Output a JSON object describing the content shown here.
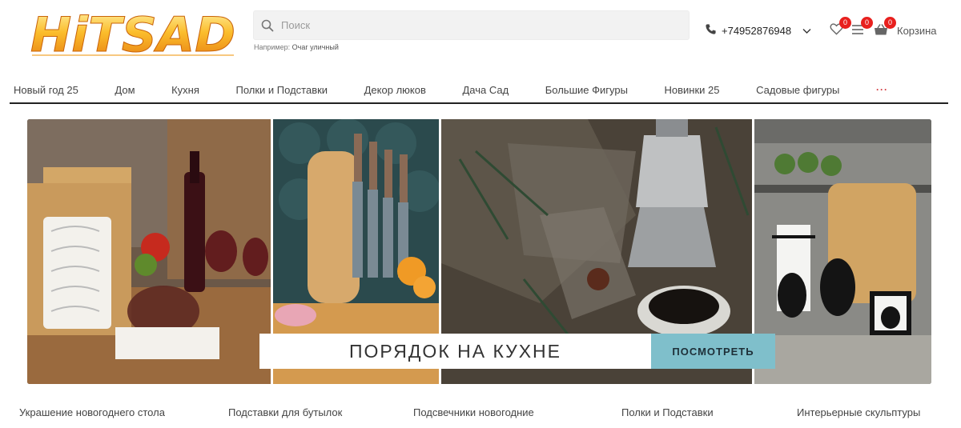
{
  "brand": {
    "logo_text": "HiTSAD"
  },
  "search": {
    "placeholder": "Поиск",
    "value": "",
    "hint_prefix": "Например:",
    "hint_example": "Очаг уличный"
  },
  "header": {
    "phone": "+74952876948",
    "wishlist_count": "0",
    "compare_count": "0",
    "cart_count": "0",
    "cart_label": "Корзина"
  },
  "nav": {
    "items": [
      "Новый год 25",
      "Дом",
      "Кухня",
      "Полки и Подставки",
      "Декор люков",
      "Дача Сад",
      "Большие Фигуры",
      "Новинки 25",
      "Садовые фигуры"
    ],
    "more": "···"
  },
  "banner": {
    "title": "ПОРЯДОК НА КУХНЕ",
    "button": "ПОСМОТРЕТЬ"
  },
  "categories": [
    "Украшение новогоднего стола",
    "Подставки для бутылок",
    "Подсвечники новогодние",
    "Полки и Подставки",
    "Интерьерные скульптуры"
  ],
  "colors": {
    "accent": "#7fbfcb",
    "badge": "#e8201e",
    "nav_border": "#222222",
    "logo_orange": "#f7a21b"
  }
}
